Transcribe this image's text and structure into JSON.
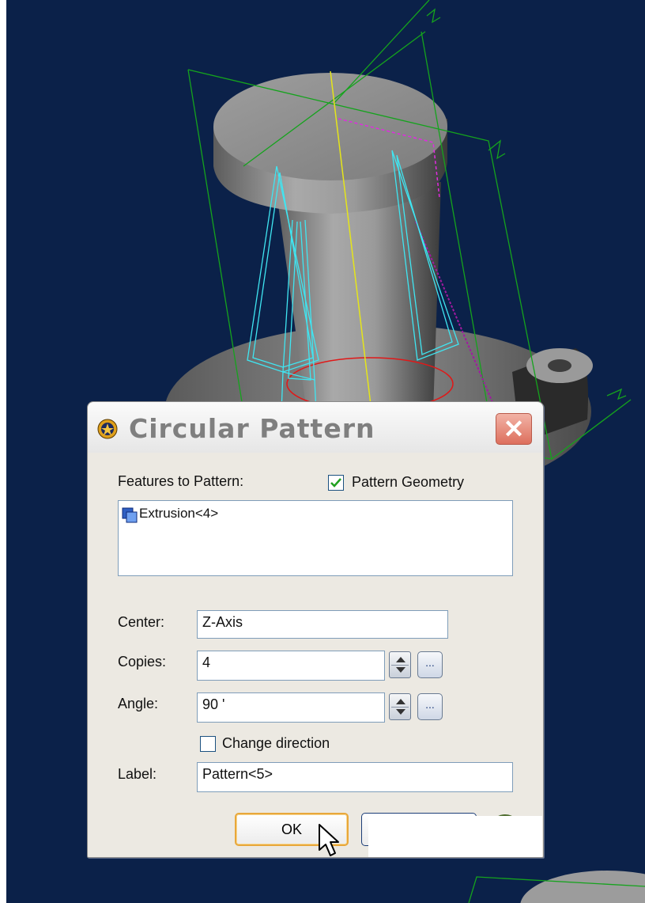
{
  "dialog": {
    "title": "Circular Pattern",
    "features_label": "Features to Pattern:",
    "pattern_geometry_label": "Pattern Geometry",
    "pattern_geometry_checked": true,
    "features": [
      {
        "label": "Extrusion<4>",
        "icon": "extrusion-icon"
      }
    ],
    "center_label": "Center:",
    "center_value": "Z-Axis",
    "copies_label": "Copies:",
    "copies_value": "4",
    "angle_label": "Angle:",
    "angle_value": "90 '",
    "change_direction_label": "Change direction",
    "change_direction_checked": false,
    "label_label": "Label:",
    "label_value": "Pattern<5>",
    "ok_label": "OK",
    "ellipsis_label": "..."
  },
  "colors": {
    "viewport_background": "#0b2149",
    "feature_wireframe": "#3fe6f2",
    "plane_lines": "#15a31d",
    "axis_line": "#e5e51a",
    "circle_edge": "#e01818"
  }
}
